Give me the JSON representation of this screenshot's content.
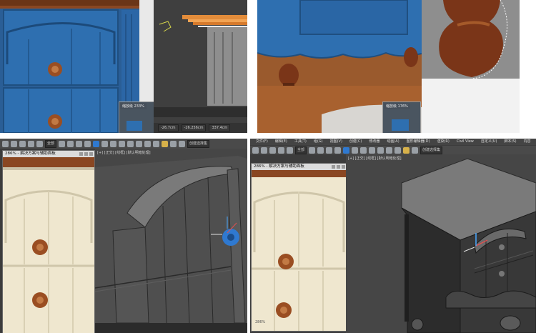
{
  "panels": {
    "top_left": {
      "zoom_label": "缩放级 233%",
      "coords": {
        "x": "-26.7cm",
        "y": "-26.256cm",
        "z": "337.4cm"
      }
    },
    "top_right": {
      "zoom_label": "缩放级 176%"
    },
    "bottom_left": {
      "toolbar": {
        "selection_filter": "全部",
        "named_selection": "创建选择集"
      },
      "window_title": "286% - 解决方案与辅助面板",
      "viewport_label": "[+] [正交] [线框] [默认明暗处理]"
    },
    "bottom_right": {
      "menu": [
        "文件(F)",
        "编辑(E)",
        "工具(T)",
        "组(G)",
        "视图(V)",
        "创建(C)",
        "修改器",
        "动画(A)",
        "图形编辑器(D)",
        "渲染(R)",
        "Civil View",
        "自定义(U)",
        "脚本(S)",
        "内容"
      ],
      "toolbar": {
        "selection_filter": "全部",
        "named_selection": "创建选择集"
      },
      "window_title": "286% - 解决方案与辅助面板",
      "viewport_label": "[+] [正交] [线框] [默认明暗处理]",
      "zoom_label": "286%"
    }
  },
  "colors": {
    "blue_paint": "#2e6fb0",
    "cream_paint": "#efe7cf",
    "wood": "#8a4722",
    "viewport_bg": "#3c3c3c",
    "highlight_blue": "#2f79d0"
  }
}
